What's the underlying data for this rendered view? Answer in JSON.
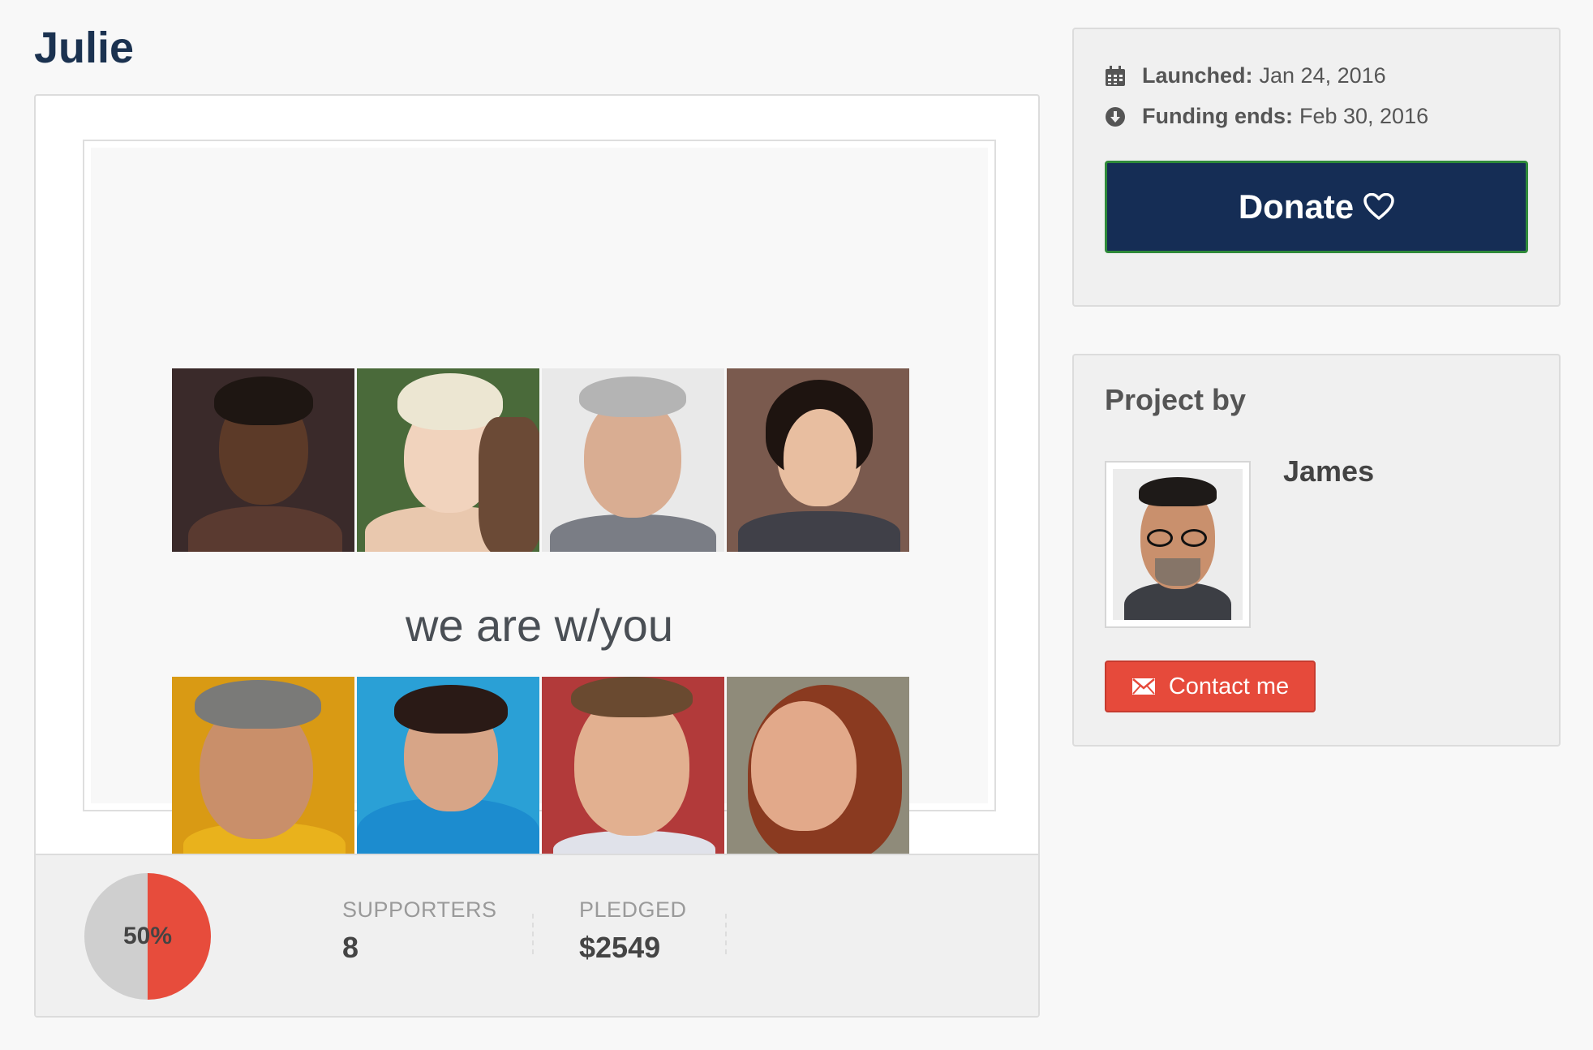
{
  "page": {
    "title": "Julie",
    "tagline": "we are w/you"
  },
  "stats": {
    "percent_label": "50%",
    "percent_funded": 0.5,
    "supporters_label": "SUPPORTERS",
    "supporters_value": "8",
    "pledged_label": "PLEDGED",
    "pledged_value": "$2549"
  },
  "campaign": {
    "launched_label": "Launched:",
    "launched_value": "Jan 24, 2016",
    "ends_label": "Funding ends:",
    "ends_value": "Feb 30, 2016",
    "donate_label": "Donate"
  },
  "creator": {
    "heading": "Project by",
    "name": "James",
    "contact_label": "Contact me"
  },
  "colors": {
    "brand_navy": "#152d55",
    "title_navy": "#1b3250",
    "contact_red": "#e64a3b",
    "pie_red": "#e74c3c",
    "pie_grey": "#cfcfcf"
  },
  "icons": {
    "launched": "calendar-icon",
    "ends": "download-circle-icon",
    "donate": "heart-outline-icon",
    "contact": "envelope-icon"
  }
}
